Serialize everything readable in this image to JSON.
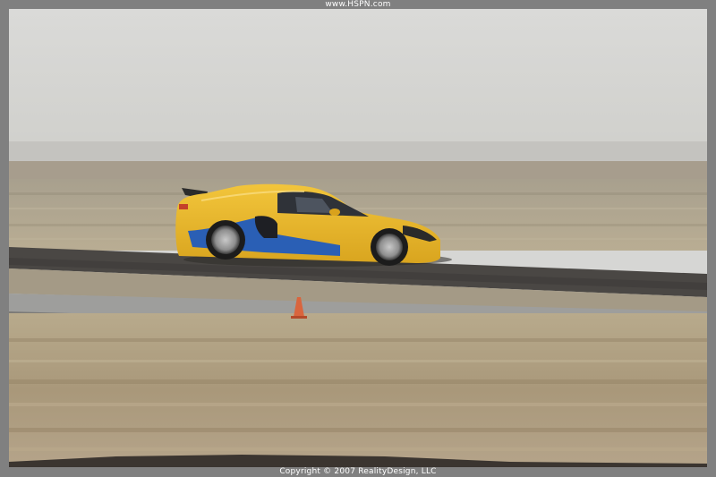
{
  "header": {
    "site_url": "www.HSPN.com"
  },
  "footer": {
    "copyright": "Copyright © 2007 RealityDesign, LLC"
  },
  "photo": {
    "subject": "yellow-sports-car",
    "colors": {
      "sky": "#dcdcda",
      "car_body": "#e3b326",
      "car_stripe": "#2a5fb5",
      "track": "#4a4744",
      "grass": "#b3a489",
      "cone": "#d9653e"
    }
  }
}
